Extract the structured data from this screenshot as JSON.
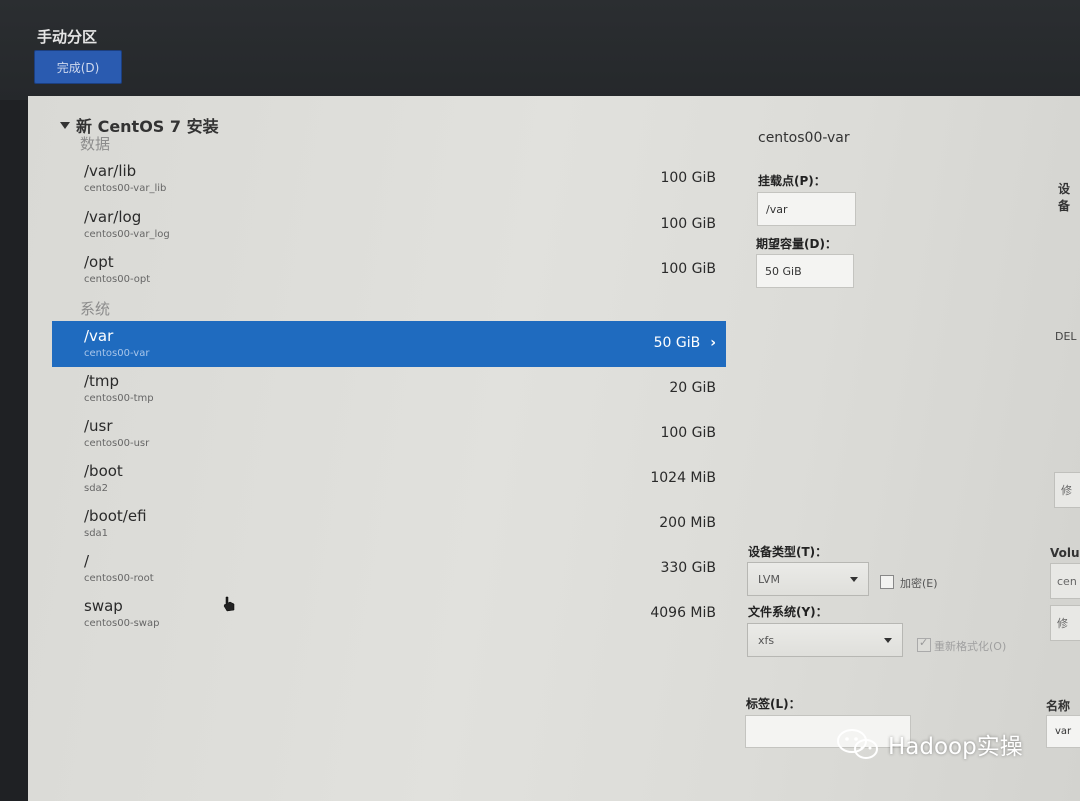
{
  "header": {
    "title": "手动分区",
    "done_button": "完成(D)"
  },
  "tree": {
    "root_label": "新 CentOS 7 安装",
    "sections": [
      {
        "label": "数据",
        "items": [
          {
            "mount": "/var/lib",
            "device": "centos00-var_lib",
            "size": "100 GiB"
          },
          {
            "mount": "/var/log",
            "device": "centos00-var_log",
            "size": "100 GiB"
          },
          {
            "mount": "/opt",
            "device": "centos00-opt",
            "size": "100 GiB"
          }
        ]
      },
      {
        "label": "系统",
        "items": [
          {
            "mount": "/var",
            "device": "centos00-var",
            "size": "50 GiB",
            "selected": true
          },
          {
            "mount": "/tmp",
            "device": "centos00-tmp",
            "size": "20 GiB"
          },
          {
            "mount": "/usr",
            "device": "centos00-usr",
            "size": "100 GiB"
          },
          {
            "mount": "/boot",
            "device": "sda2",
            "size": "1024 MiB"
          },
          {
            "mount": "/boot/efi",
            "device": "sda1",
            "size": "200 MiB"
          },
          {
            "mount": "/",
            "device": "centos00-root",
            "size": "330 GiB"
          },
          {
            "mount": "swap",
            "device": "centos00-swap",
            "size": "4096 MiB"
          }
        ]
      }
    ]
  },
  "details": {
    "title": "centos00-var",
    "mount_point_label": "挂载点(P)：",
    "mount_point_value": "/var",
    "desired_capacity_label": "期望容量(D)：",
    "desired_capacity_value": "50 GiB",
    "device_type_label": "设备类型(T)：",
    "device_type_value": "LVM",
    "encrypt_label": "加密(E)",
    "filesystem_label": "文件系统(Y)：",
    "filesystem_value": "xfs",
    "reformat_label": "重新格式化(O)",
    "tag_label": "标签(L)：",
    "tag_value": "",
    "edge_device_label": "设备",
    "edge_del_text": "DEL",
    "edge_volume_label": "Volu",
    "edge_volume_value": "cen",
    "edge_modify_text": "修",
    "edge_modify_text2": "修",
    "edge_name_label": "名称",
    "edge_name_value": "var"
  },
  "watermark": {
    "text": "Hadoop实操"
  },
  "colors": {
    "selection": "#1f6bbf",
    "header_bg": "#25282b",
    "done_button": "#2a5bb0"
  }
}
